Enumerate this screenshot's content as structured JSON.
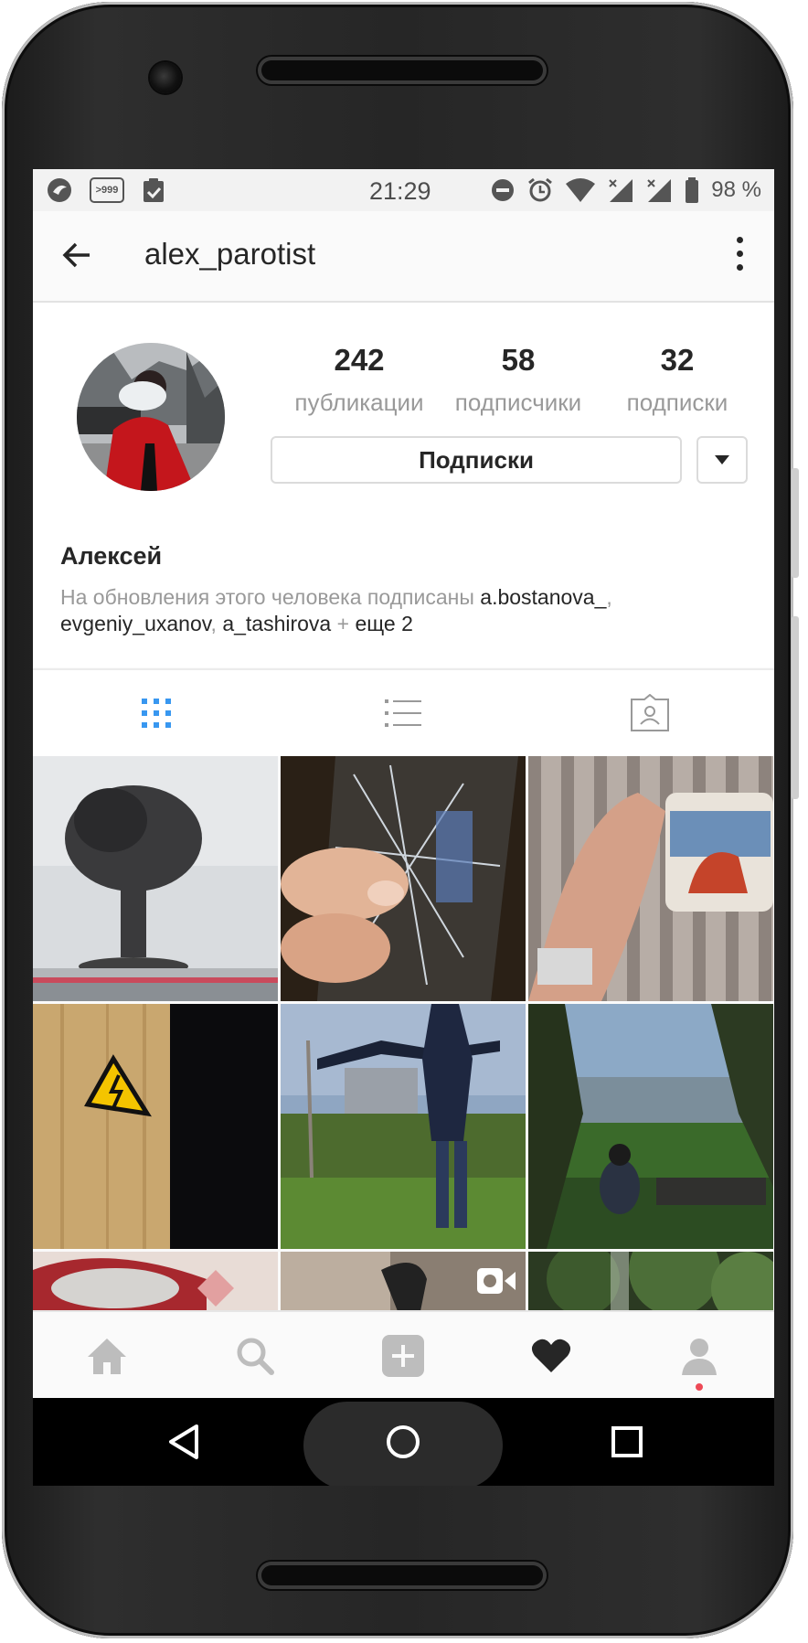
{
  "status_bar": {
    "time": "21:29",
    "notif_badge": ">999",
    "battery_pct": "98 %",
    "icons": [
      "app-icon",
      "notification-count-icon",
      "clipboard-check-icon",
      "dnd-icon",
      "alarm-icon",
      "wifi-icon",
      "signal-icon",
      "signal-icon-2",
      "battery-icon"
    ]
  },
  "app_bar": {
    "title": "alex_parotist",
    "back_icon": "arrow-left-icon",
    "menu_icon": "more-vertical-icon"
  },
  "profile": {
    "stats": [
      {
        "count": "242",
        "label": "публикации"
      },
      {
        "count": "58",
        "label": "подписчики"
      },
      {
        "count": "32",
        "label": "подписки"
      }
    ],
    "follow_button": "Подписки",
    "name": "Алексей",
    "followed_by_prefix": "На обновления этого человека подписаны ",
    "followed_by_user1": "a.bostanova_",
    "followed_by_user2": "evgeniy_uxanov",
    "followed_by_user3": "a_tashirova",
    "followed_by_more": "еще 2"
  },
  "tabs": [
    {
      "name": "grid-view",
      "icon": "grid-icon",
      "active": true
    },
    {
      "name": "list-view",
      "icon": "list-icon",
      "active": false
    },
    {
      "name": "tagged",
      "icon": "tagged-person-icon",
      "active": false
    }
  ],
  "posts": [
    {
      "subject": "mushroom-cloud"
    },
    {
      "subject": "broken-glass-in-hand"
    },
    {
      "subject": "rooster-mug"
    },
    {
      "subject": "high-voltage-sign"
    },
    {
      "subject": "person-arms-out-park"
    },
    {
      "subject": "person-sitting-hillside"
    },
    {
      "subject": "red-glass"
    },
    {
      "subject": "video-person",
      "is_video": true
    },
    {
      "subject": "trees"
    }
  ],
  "bottom_nav": [
    "home-icon",
    "search-icon",
    "add-post-icon",
    "activity-heart-icon",
    "profile-icon"
  ],
  "colors": {
    "accent": "#3897f0",
    "text": "#262626",
    "muted": "#999999",
    "notification": "#ed4956"
  }
}
